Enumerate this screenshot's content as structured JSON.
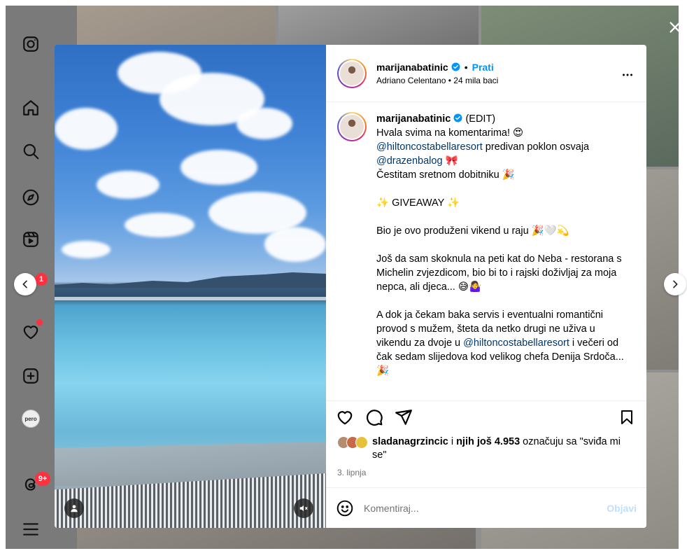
{
  "colors": {
    "accent": "#0095f6",
    "mention": "#00376b",
    "badge": "#ff3040",
    "post_disabled": "#c0dffd"
  },
  "sidebar": {
    "items": [
      {
        "icon": "instagram-logo-icon"
      },
      {
        "icon": "home-icon"
      },
      {
        "icon": "search-icon"
      },
      {
        "icon": "explore-icon"
      },
      {
        "icon": "reels-icon"
      },
      {
        "icon": "messages-icon",
        "badge": "1"
      },
      {
        "icon": "notifications-heart-icon"
      },
      {
        "icon": "create-icon"
      },
      {
        "icon": "profile-avatar",
        "label": "pero"
      },
      {
        "icon": "threads-icon",
        "badge": "9+"
      },
      {
        "icon": "menu-icon"
      }
    ]
  },
  "post": {
    "header": {
      "username": "marijanabatinic",
      "separator": "•",
      "follow_label": "Prati",
      "audio": "Adriano Celentano",
      "audio_separator": "•",
      "likes_summary": "24 mila baci"
    },
    "caption": {
      "username": "marijanabatinic",
      "edit_tag": "(EDIT)",
      "lines": [
        "Hvala svima na komentarima! 😍",
        "@hiltoncostabellaresort",
        " predivan poklon osvaja",
        "@drazenbalog",
        " 🎀",
        "Čestitam sretnom dobitniku 🎉",
        "✨ GIVEAWAY ✨",
        "Bio je ovo produženi vikend u raju 🎉🤍💫",
        "Još da sam skoknula na peti kat do Neba - restorana s Michelin zvjezdicom, bio bi to i rajski doživljaj za moja nepca, ali djeca... 😅🤷‍♀️",
        "A dok ja čekam baka servis i eventualni romantični provod s mužem, šteta da netko drugi ne uživa u vikendu za dvoje u",
        "@hiltoncostabellaresort",
        " i večeri od čak sedam slijedova kod velikog chefa Denija Srdoča... 🎉"
      ]
    },
    "likes": {
      "first_user": "sladanagrzincic",
      "connector": " i ",
      "others": "njih još 4.953",
      "suffix": " označuju sa \"sviđa mi se\""
    },
    "date": "3. lipnja",
    "comment": {
      "placeholder": "Komentiraj...",
      "value": "",
      "post_label": "Objavi"
    }
  }
}
